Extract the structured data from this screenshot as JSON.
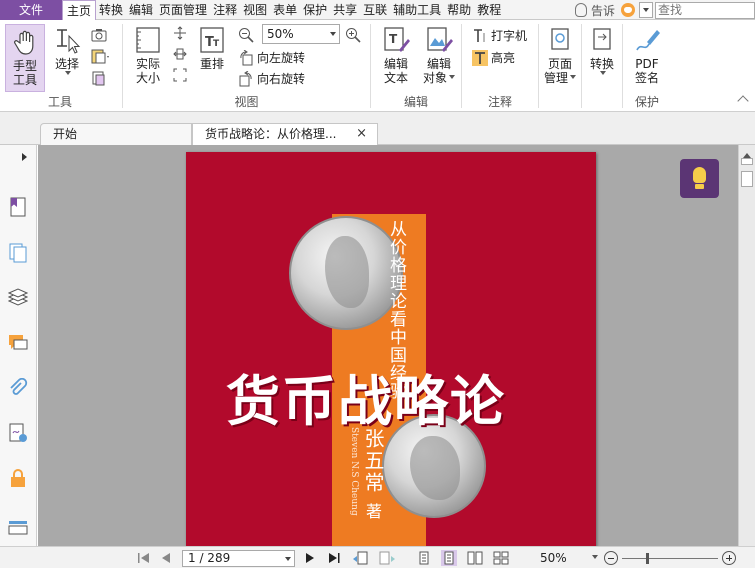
{
  "menubar": {
    "file": "文件",
    "items": [
      "主页",
      "转换",
      "编辑",
      "页面管理",
      "注释",
      "视图",
      "表单",
      "保护",
      "共享",
      "互联",
      "辅助工具",
      "帮助",
      "教程"
    ],
    "active_index": 0,
    "tell_me": "告诉",
    "search_placeholder": "查找"
  },
  "ribbon": {
    "tools": {
      "label": "工具",
      "hand_line1": "手型",
      "hand_line2": "工具",
      "select": "选择"
    },
    "view": {
      "label": "视图",
      "actual_line1": "实际",
      "actual_line2": "大小",
      "reflow": "重排",
      "zoom_value": "50%",
      "rotate_left": "向左旋转",
      "rotate_right": "向右旋转"
    },
    "edit": {
      "label": "编辑",
      "edit_text_line1": "编辑",
      "edit_text_line2": "文本",
      "edit_obj_line1": "编辑",
      "edit_obj_line2": "对象"
    },
    "comment": {
      "label": "注释",
      "typewriter": "打字机",
      "highlight": "高亮"
    },
    "page_mgmt": {
      "line1": "页面",
      "line2": "管理"
    },
    "convert": {
      "label": "转换"
    },
    "protect": {
      "label": "保护",
      "sign_line1": "PDF",
      "sign_line2": "签名"
    }
  },
  "tabs": {
    "home": "开始",
    "doc": "货币战略论：从价格理...",
    "close": "×"
  },
  "cover": {
    "subtitle": "从价格理论看中国经验",
    "title": "货币战略论",
    "author_en": "Steven N.S Cheung",
    "author_cn": "张五常",
    "author_suffix": "著"
  },
  "statusbar": {
    "page_value": "1 / 289",
    "zoom": "50%"
  },
  "colors": {
    "accent": "#7d4fa3",
    "cover_red": "#b20a2c",
    "cover_orange": "#ee7b22",
    "tip_button": "#5b3574"
  },
  "icons": [
    "hand-icon",
    "select-icon",
    "camera-icon",
    "clipboard-icon",
    "actual-size-icon",
    "fit-icon",
    "reflow-icon",
    "zoom-out-icon",
    "zoom-in-icon",
    "rotate-left-icon",
    "rotate-right-icon",
    "edit-text-icon",
    "edit-object-icon",
    "typewriter-icon",
    "highlight-icon",
    "page-manage-icon",
    "convert-icon",
    "pdf-sign-icon",
    "bookmark-icon",
    "pages-icon",
    "layers-icon",
    "comments-icon",
    "attachment-icon",
    "signature-icon",
    "lock-icon",
    "lightbulb-icon"
  ]
}
